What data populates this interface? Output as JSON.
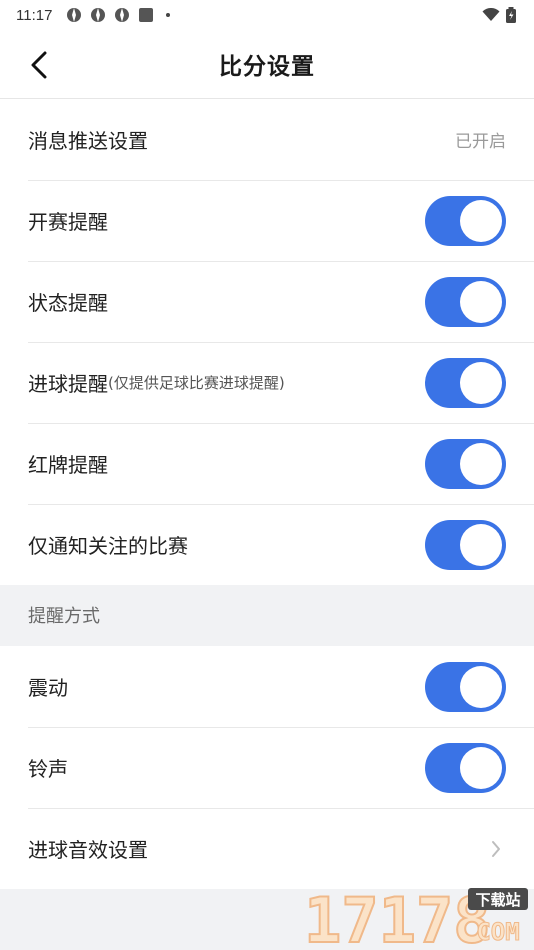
{
  "status_bar": {
    "time": "11:17"
  },
  "header": {
    "title": "比分设置"
  },
  "push": {
    "label": "消息推送设置",
    "value": "已开启"
  },
  "toggles": [
    {
      "label": "开赛提醒",
      "note": "",
      "on": true
    },
    {
      "label": "状态提醒",
      "note": "",
      "on": true
    },
    {
      "label": "进球提醒",
      "note": "(仅提供足球比赛进球提醒)",
      "on": true
    },
    {
      "label": "红牌提醒",
      "note": "",
      "on": true
    },
    {
      "label": "仅通知关注的比赛",
      "note": "",
      "on": true
    }
  ],
  "reminder_section": {
    "title": "提醒方式"
  },
  "reminder_items": [
    {
      "label": "震动",
      "on": true
    },
    {
      "label": "铃声",
      "on": true
    }
  ],
  "goal_sound": {
    "label": "进球音效设置"
  },
  "watermark": {
    "number": "17178",
    "tag": "下载站",
    "domain": "COM"
  },
  "colors": {
    "accent": "#3a73e6",
    "background": "#f1f2f4"
  }
}
